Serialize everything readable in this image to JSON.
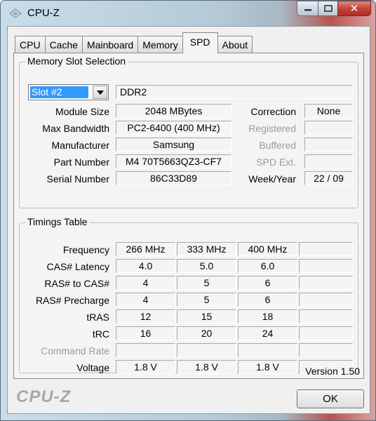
{
  "window": {
    "title": "CPU-Z",
    "icon": "cpu-z-logo-icon",
    "close_glyph": "✕"
  },
  "tabs": [
    {
      "label": "CPU"
    },
    {
      "label": "Cache"
    },
    {
      "label": "Mainboard"
    },
    {
      "label": "Memory"
    },
    {
      "label": "SPD",
      "active": true
    },
    {
      "label": "About"
    }
  ],
  "slot_selection": {
    "title": "Memory Slot Selection",
    "slot_value": "Slot #2",
    "memory_type": "DDR2",
    "module_size_label": "Module Size",
    "module_size": "2048 MBytes",
    "max_bandwidth_label": "Max Bandwidth",
    "max_bandwidth": "PC2-6400 (400 MHz)",
    "manufacturer_label": "Manufacturer",
    "manufacturer": "Samsung",
    "part_number_label": "Part Number",
    "part_number": "M4 70T5663QZ3-CF7",
    "serial_number_label": "Serial Number",
    "serial_number": "86C33D89",
    "correction_label": "Correction",
    "correction": "None",
    "registered_label": "Registered",
    "registered": "",
    "buffered_label": "Buffered",
    "buffered": "",
    "spd_ext_label": "SPD Ext.",
    "spd_ext": "",
    "week_year_label": "Week/Year",
    "week_year": "22 / 09"
  },
  "timings": {
    "title": "Timings Table",
    "rows": [
      {
        "label": "Frequency",
        "values": [
          "266 MHz",
          "333 MHz",
          "400 MHz",
          ""
        ]
      },
      {
        "label": "CAS# Latency",
        "values": [
          "4.0",
          "5.0",
          "6.0",
          ""
        ]
      },
      {
        "label": "RAS# to CAS#",
        "values": [
          "4",
          "5",
          "6",
          ""
        ]
      },
      {
        "label": "RAS# Precharge",
        "values": [
          "4",
          "5",
          "6",
          ""
        ]
      },
      {
        "label": "tRAS",
        "values": [
          "12",
          "15",
          "18",
          ""
        ]
      },
      {
        "label": "tRC",
        "values": [
          "16",
          "20",
          "24",
          ""
        ]
      },
      {
        "label": "Command Rate",
        "values": [
          "",
          "",
          "",
          ""
        ],
        "disabled": true
      },
      {
        "label": "Voltage",
        "values": [
          "1.8 V",
          "1.8 V",
          "1.8 V",
          ""
        ]
      }
    ]
  },
  "footer": {
    "version": "Version 1.50",
    "brand": "CPU-Z",
    "ok_label": "OK"
  }
}
